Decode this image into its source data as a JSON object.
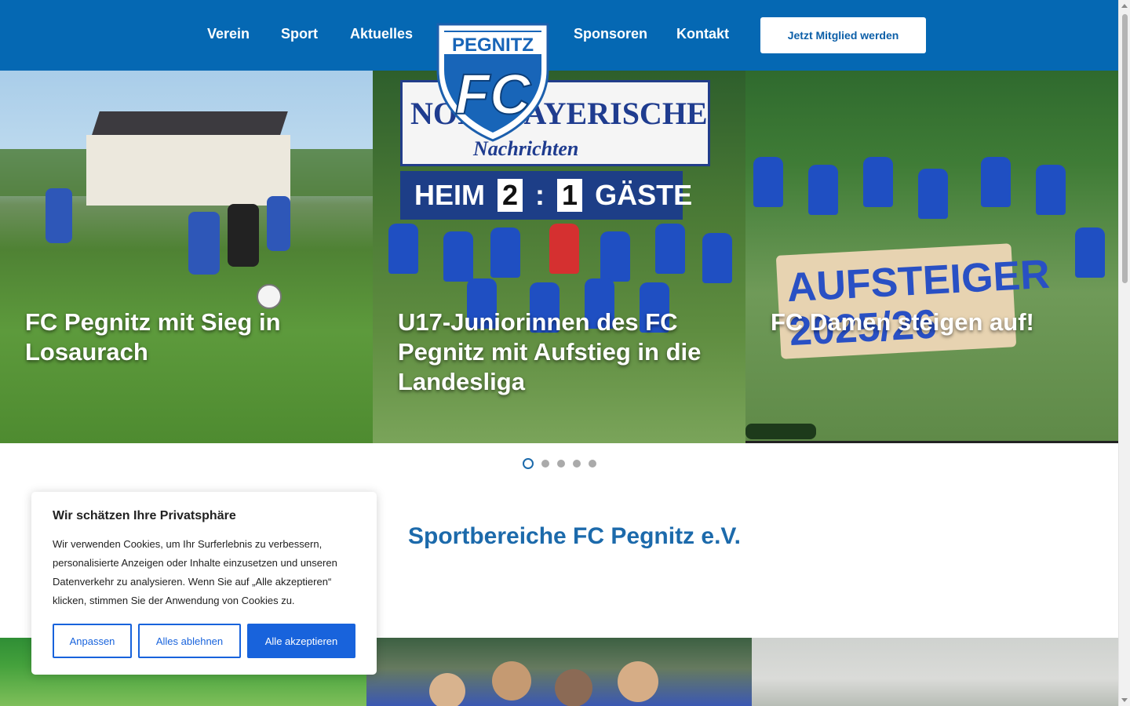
{
  "header": {
    "nav_left": [
      "Verein",
      "Sport",
      "Aktuelles"
    ],
    "nav_right": [
      "Sponsoren",
      "Kontakt"
    ],
    "cta_label": "Jetzt Mitglied werden",
    "logo_text": "PEGNITZ",
    "logo_letters": "FC"
  },
  "slider": {
    "slides": [
      {
        "title": "FC Pegnitz mit Sieg in Losaurach"
      },
      {
        "title": "U17-Juniorinnen des FC Pegnitz mit Aufstieg in die Landesliga"
      },
      {
        "title": "FC Damen steigen auf!"
      }
    ],
    "total_dots": 5,
    "active_dot": 1,
    "sign_line1": "NORDBAYERISCHE",
    "sign_line2": "Nachrichten",
    "score": {
      "home_label": "HEIM",
      "home": "2",
      "sep": ":",
      "away": "1",
      "away_label": "GÄSTE"
    },
    "banner": {
      "line1": "AUFSTEIGER",
      "line2": "2025/26"
    }
  },
  "main": {
    "section_title": "Sportbereiche FC Pegnitz e.V."
  },
  "cookie": {
    "title": "Wir schätzen Ihre Privatsphäre",
    "text": "Wir verwenden Cookies, um Ihr Surferlebnis zu verbessern, personalisierte Anzeigen oder Inhalte einzusetzen und unseren Datenverkehr zu analysieren. Wenn Sie auf „Alle akzeptieren“ klicken, stimmen Sie der Anwendung von Cookies zu.",
    "btn_customize": "Anpassen",
    "btn_reject": "Alles ablehnen",
    "btn_accept": "Alle akzeptieren"
  },
  "colors": {
    "brand_blue": "#0568b3",
    "link_blue": "#1c6aab",
    "cookie_blue": "#1863dc"
  }
}
